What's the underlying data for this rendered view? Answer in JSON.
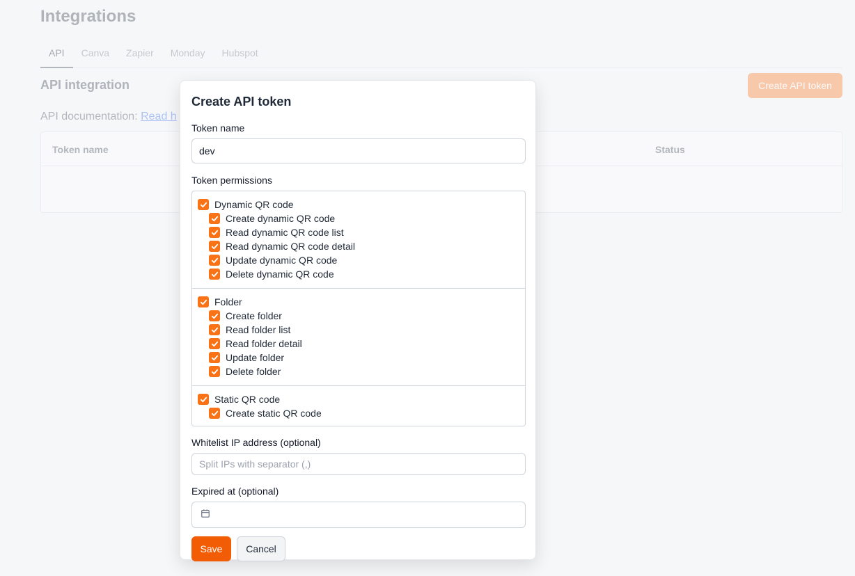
{
  "page": {
    "title": "Integrations",
    "tabs": [
      {
        "label": "API",
        "active": true
      },
      {
        "label": "Canva",
        "active": false
      },
      {
        "label": "Zapier",
        "active": false
      },
      {
        "label": "Monday",
        "active": false
      },
      {
        "label": "Hubspot",
        "active": false
      }
    ],
    "section_title": "API integration",
    "create_button": "Create API token",
    "doc_label": "API documentation:",
    "doc_link": "Read h",
    "table_headers": {
      "name": "Token name",
      "status": "Status"
    }
  },
  "modal": {
    "title": "Create API token",
    "token_name_label": "Token name",
    "token_name_value": "dev",
    "permissions_label": "Token permissions",
    "groups": [
      {
        "label": "Dynamic QR code",
        "checked": true,
        "items": [
          {
            "label": "Create dynamic QR code",
            "checked": true
          },
          {
            "label": "Read dynamic QR code list",
            "checked": true
          },
          {
            "label": "Read dynamic QR code detail",
            "checked": true
          },
          {
            "label": "Update dynamic QR code",
            "checked": true
          },
          {
            "label": "Delete dynamic QR code",
            "checked": true
          }
        ]
      },
      {
        "label": "Folder",
        "checked": true,
        "items": [
          {
            "label": "Create folder",
            "checked": true
          },
          {
            "label": "Read folder list",
            "checked": true
          },
          {
            "label": "Read folder detail",
            "checked": true
          },
          {
            "label": "Update folder",
            "checked": true
          },
          {
            "label": "Delete folder",
            "checked": true
          }
        ]
      },
      {
        "label": "Static QR code",
        "checked": true,
        "items": [
          {
            "label": "Create static QR code",
            "checked": true
          }
        ]
      }
    ],
    "whitelist_label": "Whitelist IP address (optional)",
    "whitelist_placeholder": "Split IPs with separator (,)",
    "expired_label": "Expired at (optional)",
    "expired_icon": "calendar-icon",
    "save_label": "Save",
    "cancel_label": "Cancel"
  },
  "colors": {
    "accent": "#f97316",
    "save": "#f25c05"
  }
}
